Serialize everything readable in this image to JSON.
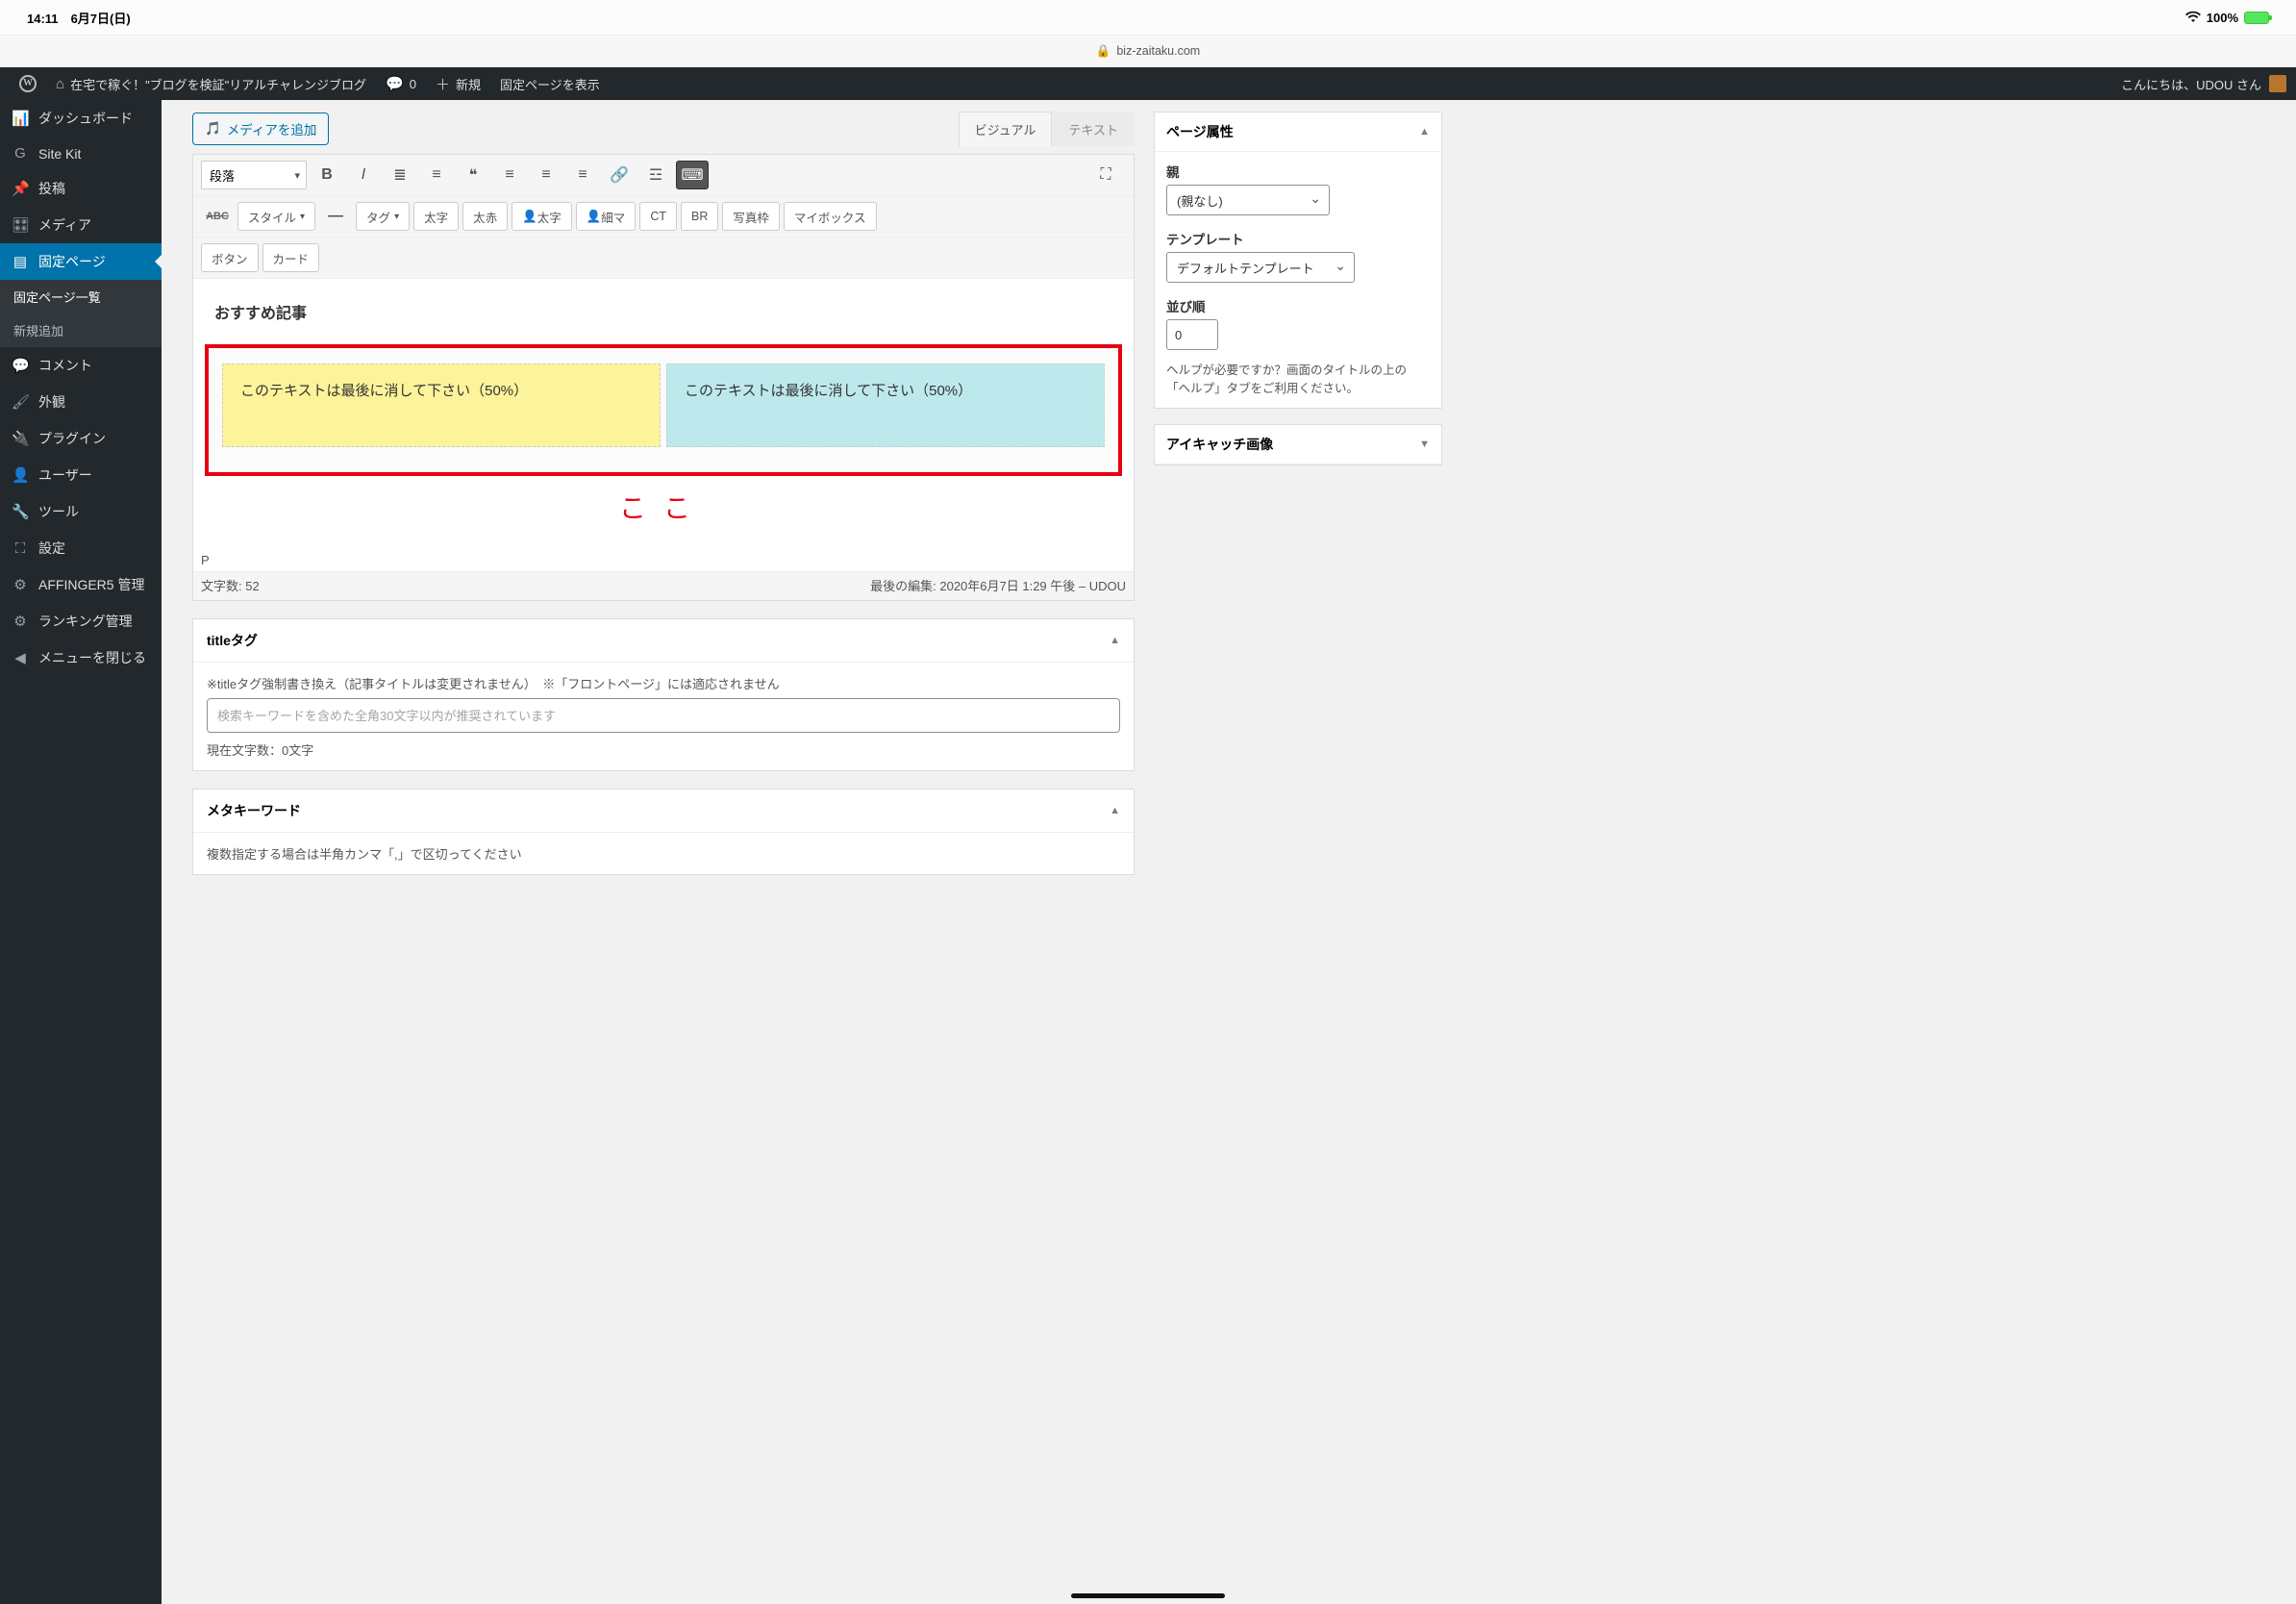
{
  "status": {
    "time": "14:11",
    "date": "6月7日(日)",
    "wifi": "􀙇",
    "battery": "100%"
  },
  "url": {
    "host": "biz-zaitaku.com"
  },
  "toolbar": {
    "site": "在宅で稼ぐ！\"ブログを検証\"リアルチャレンジブログ",
    "comments": "0",
    "new": "新規",
    "view": "固定ページを表示",
    "greeting": "こんにちは、UDOU さん"
  },
  "sidebar": {
    "items": [
      {
        "icon": "📊",
        "label": "ダッシュボード"
      },
      {
        "icon": "G",
        "label": "Site Kit"
      },
      {
        "icon": "📌",
        "label": "投稿"
      },
      {
        "icon": "🎛",
        "label": "メディア"
      },
      {
        "icon": "▤",
        "label": "固定ページ",
        "active": true
      },
      {
        "icon": "💬",
        "label": "コメント"
      },
      {
        "icon": "🖌",
        "label": "外観"
      },
      {
        "icon": "🔌",
        "label": "プラグイン"
      },
      {
        "icon": "👤",
        "label": "ユーザー"
      },
      {
        "icon": "🔧",
        "label": "ツール"
      },
      {
        "icon": "⛶",
        "label": "設定"
      },
      {
        "icon": "⚙",
        "label": "AFFINGER5 管理"
      },
      {
        "icon": "⚙",
        "label": "ランキング管理"
      },
      {
        "icon": "◀",
        "label": "メニューを閉じる"
      }
    ],
    "sub": [
      {
        "label": "固定ページ一覧",
        "cur": true
      },
      {
        "label": "新規追加"
      }
    ]
  },
  "editor": {
    "media_btn": "メディアを追加",
    "tab_visual": "ビジュアル",
    "tab_text": "テキスト",
    "format_sel": "段落",
    "style_sel": "スタイル",
    "tag_sel": "タグ",
    "futoji": "太字",
    "futored": "太赤",
    "personB": "太字",
    "personS": "細マ",
    "ct": "CT",
    "br": "BR",
    "photo": "写真枠",
    "mybox": "マイボックス",
    "button": "ボタン",
    "card": "カード",
    "heading": "おすすめ記事",
    "col1": "このテキストは最後に消して下さい（50%）",
    "col2": "このテキストは最後に消して下さい（50%）",
    "koko": "ここ",
    "path": "P",
    "wc_label": "文字数: ",
    "wc": "52",
    "last_label": "最後の編集: ",
    "last": "2020年6月7日 1:29 午後 – UDOU"
  },
  "titlebox": {
    "title": "titleタグ",
    "note": "※titleタグ強制書き換え（記事タイトルは変更されません）　※「フロントページ」には適応されません",
    "ph": "検索キーワードを含めた全角30文字以内が推奨されています",
    "count": "現在文字数：0文字"
  },
  "metakw": {
    "title": "メタキーワード",
    "note": "複数指定する場合は半角カンマ「,」で区切ってください"
  },
  "attrs": {
    "title": "ページ属性",
    "parent_l": "親",
    "parent_v": "(親なし)",
    "tmpl_l": "テンプレート",
    "tmpl_v": "デフォルトテンプレート",
    "order_l": "並び順",
    "order_v": "0",
    "help": "ヘルプが必要ですか？画面のタイトルの上の「ヘルプ」タブをご利用ください。"
  },
  "thumb": {
    "title": "アイキャッチ画像"
  }
}
